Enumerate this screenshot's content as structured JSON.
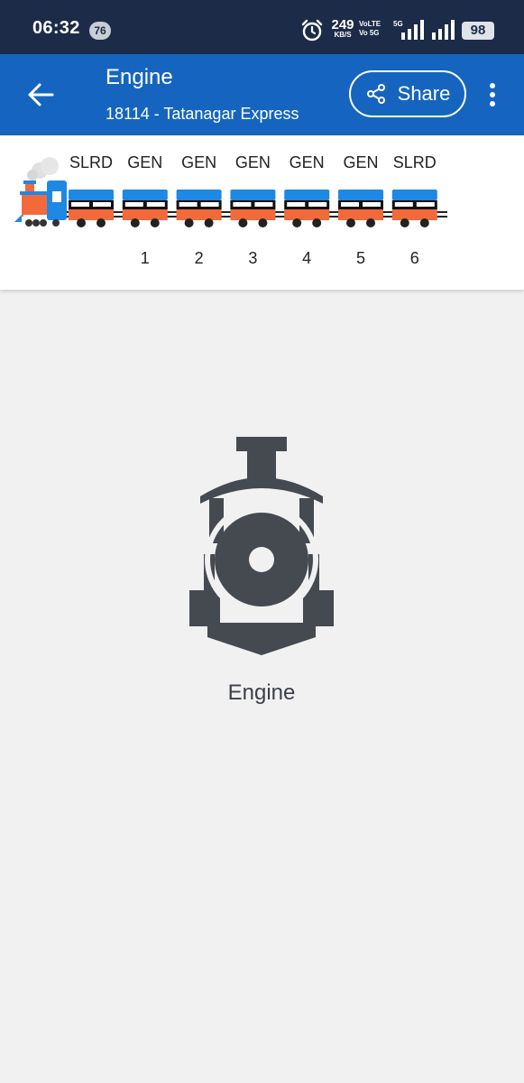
{
  "status_bar": {
    "time": "06:32",
    "notification_count": "76",
    "net_speed_value": "249",
    "net_speed_unit": "KB/S",
    "volte_line1": "VoLTE",
    "volte_line2": "Vo 5G",
    "network_type": "5G",
    "battery": "98",
    "icons": [
      "alarm-icon",
      "signal-icon",
      "signal-icon"
    ]
  },
  "app_bar": {
    "title": "Engine",
    "subtitle": "18114 - Tatanagar Express",
    "share_label": "Share",
    "icons": [
      "arrow-back-icon",
      "share-icon",
      "more-vert-icon"
    ],
    "color": "#1565c0"
  },
  "coaches": [
    {
      "type": "SLRD",
      "number": ""
    },
    {
      "type": "GEN",
      "number": "1"
    },
    {
      "type": "GEN",
      "number": "2"
    },
    {
      "type": "GEN",
      "number": "3"
    },
    {
      "type": "GEN",
      "number": "4"
    },
    {
      "type": "GEN",
      "number": "5"
    },
    {
      "type": "SLRD",
      "number": "6"
    }
  ],
  "selected": {
    "icon": "locomotive-icon",
    "label": "Engine"
  },
  "colors": {
    "coach_roof": "#1e88e5",
    "coach_body": "#f26a3a",
    "engine_icon": "#454950"
  }
}
